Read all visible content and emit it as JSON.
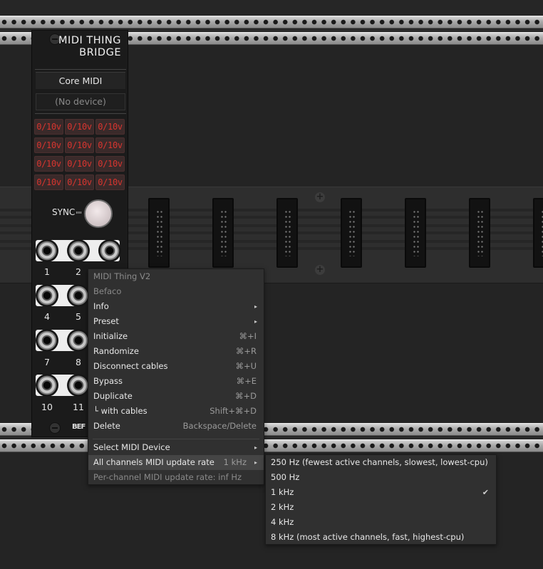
{
  "module": {
    "title_line1": "MIDI THING",
    "title_line2": "BRIDGE",
    "driver": "Core MIDI",
    "device": "(No device)",
    "ranges": [
      "0/10v",
      "0/10v",
      "0/10v",
      "0/10v",
      "0/10v",
      "0/10v",
      "0/10v",
      "0/10v",
      "0/10v",
      "0/10v",
      "0/10v",
      "0/10v"
    ],
    "sync_label": "SYNC",
    "jack_numbers": [
      "1",
      "2",
      "4",
      "5",
      "7",
      "8",
      "10",
      "11"
    ],
    "logo_text": "BEF"
  },
  "context_menu": {
    "header_model": "MIDI Thing V2",
    "header_brand": "Befaco",
    "items": [
      {
        "label": "Info",
        "submenu": true
      },
      {
        "label": "Preset",
        "submenu": true
      },
      {
        "label": "Initialize",
        "shortcut": "⌘+I"
      },
      {
        "label": "Randomize",
        "shortcut": "⌘+R"
      },
      {
        "label": "Disconnect cables",
        "shortcut": "⌘+U"
      },
      {
        "label": "Bypass",
        "shortcut": "⌘+E"
      },
      {
        "label": "Duplicate",
        "shortcut": "⌘+D"
      },
      {
        "label": "└ with cables",
        "shortcut": "Shift+⌘+D"
      },
      {
        "label": "Delete",
        "shortcut": "Backspace/Delete"
      }
    ],
    "select_midi_device": "Select MIDI Device",
    "update_rate_label": "All channels MIDI update rate",
    "update_rate_value": "1 kHz",
    "per_channel_rate": "Per-channel MIDI update rate: inf Hz"
  },
  "rate_submenu": {
    "options": [
      "250 Hz (fewest active channels, slowest, lowest-cpu)",
      "500 Hz",
      "1 kHz",
      "2 kHz",
      "4 kHz",
      "8 kHz (most active channels, fast, highest-cpu)"
    ],
    "selected_index": 2,
    "check_mark": "✔"
  },
  "icons": {
    "submenu_arrow": "▸",
    "screw": "+"
  }
}
